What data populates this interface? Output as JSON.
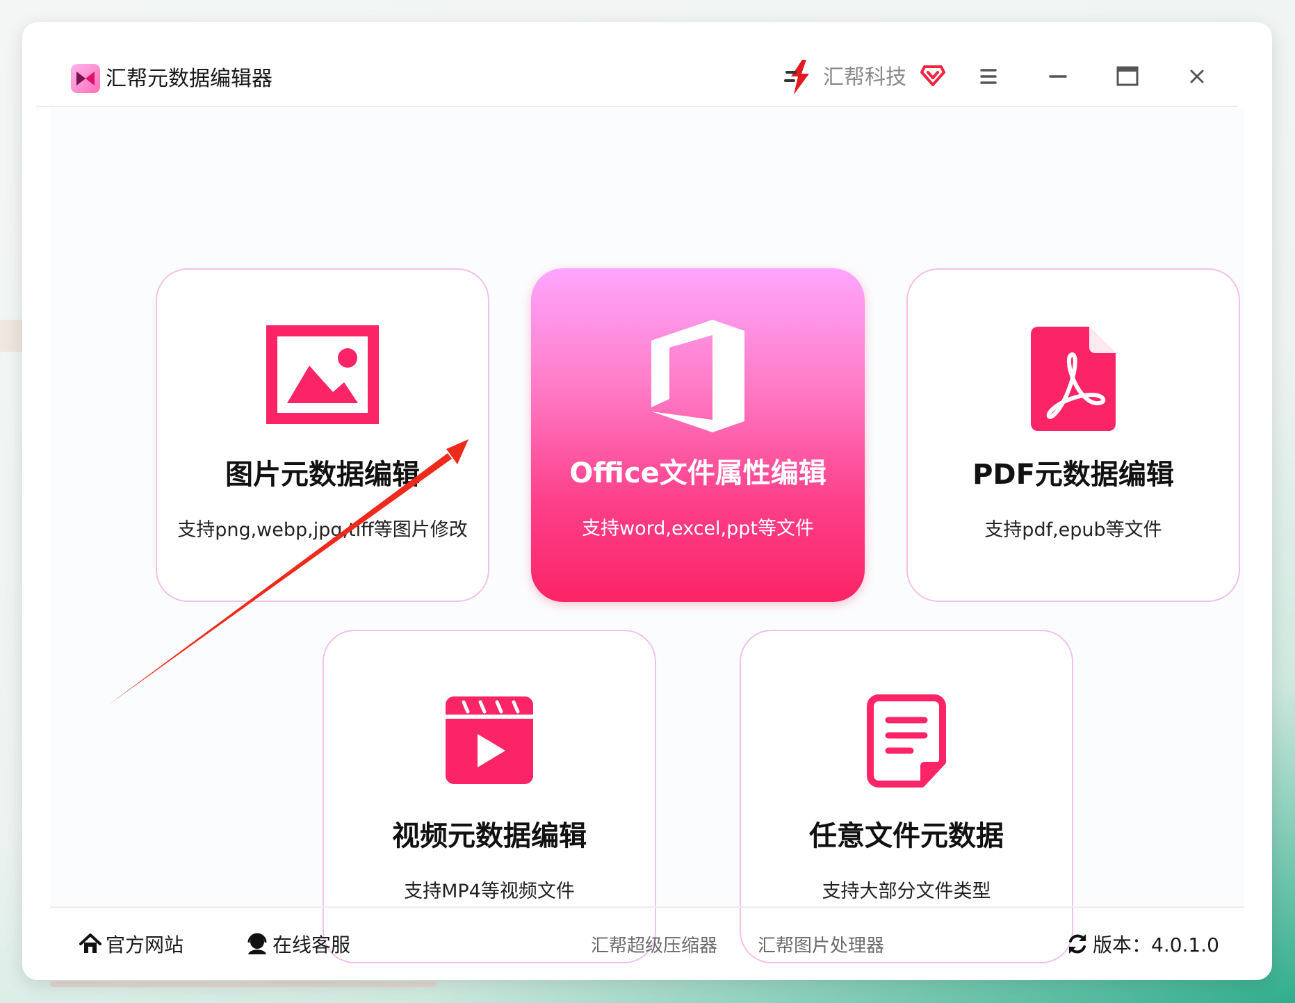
{
  "app": {
    "title": "汇帮元数据编辑器"
  },
  "brand": {
    "name": "汇帮科技"
  },
  "window_controls": {
    "menu": "menu-icon",
    "minimize": "minimize-icon",
    "maximize": "maximize-icon",
    "close": "close-icon"
  },
  "cards": [
    {
      "title": "图片元数据编辑",
      "subtitle": "支持png,webp,jpg,tiff等图片修改",
      "icon": "image-icon"
    },
    {
      "title": "Office文件属性编辑",
      "subtitle": "支持word,excel,ppt等文件",
      "icon": "office-icon",
      "selected": true
    },
    {
      "title": "PDF元数据编辑",
      "subtitle": "支持pdf,epub等文件",
      "icon": "pdf-icon"
    },
    {
      "title": "视频元数据编辑",
      "subtitle": "支持MP4等视频文件",
      "icon": "video-icon"
    },
    {
      "title": "任意文件元数据",
      "subtitle": "支持大部分文件类型",
      "icon": "document-icon"
    }
  ],
  "footer": {
    "website": "官方网站",
    "support": "在线客服",
    "compressor": "汇帮超级压缩器",
    "image_processor": "汇帮图片处理器",
    "version": "版本：4.0.1.0"
  },
  "colors": {
    "accent": "#fb2466",
    "card_border": "#f1c0ec",
    "arrow": "#ee2a1c"
  }
}
